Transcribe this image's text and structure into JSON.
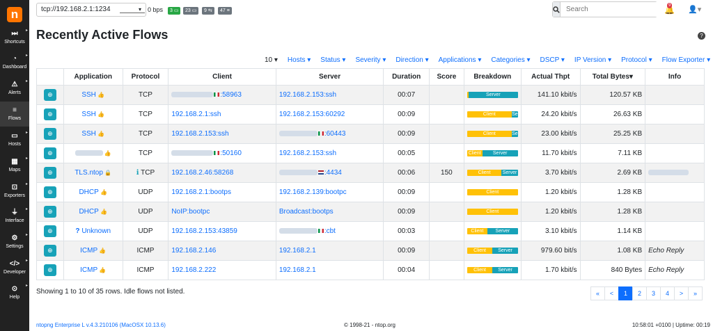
{
  "sidebar": {
    "logo": "n",
    "items": [
      {
        "icon": "⏭",
        "label": "Shortcuts",
        "icon_name": "forward-icon"
      },
      {
        "icon": "◔",
        "label": "Dashboard",
        "icon_name": "gauge-icon"
      },
      {
        "icon": "⚠",
        "label": "Alerts",
        "icon_name": "warning-icon"
      },
      {
        "icon": "≡",
        "label": "Flows",
        "icon_name": "stream-icon"
      },
      {
        "icon": "▭",
        "label": "Hosts",
        "icon_name": "laptop-icon"
      },
      {
        "icon": "▦",
        "label": "Maps",
        "icon_name": "map-icon"
      },
      {
        "icon": "⊡",
        "label": "Exporters",
        "icon_name": "exporter-icon"
      },
      {
        "icon": "⏚",
        "label": "Interface",
        "icon_name": "ethernet-icon"
      },
      {
        "icon": "⚙",
        "label": "Settings",
        "icon_name": "gear-icon"
      },
      {
        "icon": "</>",
        "label": "Developer",
        "icon_name": "code-icon"
      },
      {
        "icon": "⊙",
        "label": "Help",
        "icon_name": "lifebuoy-icon"
      }
    ]
  },
  "topbar": {
    "interface": "tcp://192.168.2.1:1234",
    "throughput": "0 bps",
    "badges": [
      {
        "text": "3 ▭",
        "color": "#28a745"
      },
      {
        "text": "23 ▭",
        "color": "#6c757d"
      },
      {
        "text": "9 ⇆",
        "color": "#6c757d"
      },
      {
        "text": "47 ≡",
        "color": "#6c757d"
      }
    ],
    "search_placeholder": "Search",
    "alert_count": "9"
  },
  "page": {
    "title": "Recently Active Flows"
  },
  "filters": [
    {
      "label": "10 ▾",
      "dark": true
    },
    {
      "label": "Hosts ▾"
    },
    {
      "label": "Status ▾"
    },
    {
      "label": "Severity ▾"
    },
    {
      "label": "Direction ▾"
    },
    {
      "label": "Applications ▾"
    },
    {
      "label": "Categories ▾"
    },
    {
      "label": "DSCP ▾"
    },
    {
      "label": "IP Version ▾"
    },
    {
      "label": "Protocol ▾"
    },
    {
      "label": "Flow Exporter ▾"
    }
  ],
  "table": {
    "columns": [
      "",
      "Application",
      "Protocol",
      "Client",
      "Server",
      "Duration",
      "Score",
      "Breakdown",
      "Actual Thpt",
      "Total Bytes▾",
      "Info"
    ],
    "rows": [
      {
        "app": "SSH",
        "app_icon": "thumb",
        "proto": "TCP",
        "proto_info": false,
        "client": ":58963",
        "client_blur": 60,
        "client_flag": "it",
        "server": "192.168.2.153:ssh",
        "server_blur": 0,
        "server_flag": "",
        "duration": "00:07",
        "score": "",
        "cl": 3,
        "sv": 97,
        "cl_label": "",
        "sv_label": "Server",
        "thpt": "141.10 kbit/s",
        "bytes": "120.57 KB",
        "info": "",
        "info_blur": false
      },
      {
        "app": "SSH",
        "app_icon": "thumb",
        "proto": "TCP",
        "proto_info": false,
        "client": "192.168.2.1:ssh",
        "client_blur": 0,
        "client_flag": "",
        "server": "192.168.2.153:60292",
        "server_blur": 0,
        "server_flag": "",
        "duration": "00:09",
        "score": "",
        "cl": 88,
        "sv": 12,
        "cl_label": "Client",
        "sv_label": "Se",
        "thpt": "24.20 kbit/s",
        "bytes": "26.63 KB",
        "info": "",
        "info_blur": false
      },
      {
        "app": "SSH",
        "app_icon": "thumb",
        "proto": "TCP",
        "proto_info": false,
        "client": "192.168.2.153:ssh",
        "client_blur": 0,
        "client_flag": "",
        "server": ":60443",
        "server_blur": 55,
        "server_flag": "it",
        "duration": "00:09",
        "score": "",
        "cl": 88,
        "sv": 12,
        "cl_label": "Client",
        "sv_label": "Se",
        "thpt": "23.00 kbit/s",
        "bytes": "25.25 KB",
        "info": "",
        "info_blur": false
      },
      {
        "app": "",
        "app_icon": "blur-thumb",
        "proto": "TCP",
        "proto_info": false,
        "client": ":50160",
        "client_blur": 60,
        "client_flag": "it",
        "server": "192.168.2.153:ssh",
        "server_blur": 0,
        "server_flag": "",
        "duration": "00:05",
        "score": "",
        "cl": 30,
        "sv": 70,
        "cl_label": "Client",
        "sv_label": "Server",
        "thpt": "11.70 kbit/s",
        "bytes": "7.11 KB",
        "info": "",
        "info_blur": false
      },
      {
        "app": "TLS.ntop",
        "app_icon": "lock",
        "proto": "TCP",
        "proto_info": true,
        "client": "192.168.2.46:58268",
        "client_blur": 0,
        "client_flag": "",
        "server": ":4434",
        "server_blur": 55,
        "server_flag": "nl",
        "duration": "00:06",
        "score": "150",
        "cl": 68,
        "sv": 32,
        "cl_label": "Client",
        "sv_label": "Server",
        "thpt": "3.70 kbit/s",
        "bytes": "2.69 KB",
        "info": "",
        "info_blur": true
      },
      {
        "app": "DHCP",
        "app_icon": "thumb",
        "proto": "UDP",
        "proto_info": false,
        "client": "192.168.2.1:bootps",
        "client_blur": 0,
        "client_flag": "",
        "server": "192.168.2.139:bootpc",
        "server_blur": 0,
        "server_flag": "",
        "duration": "00:09",
        "score": "",
        "cl": 100,
        "sv": 0,
        "cl_label": "Client",
        "sv_label": "",
        "thpt": "1.20 kbit/s",
        "bytes": "1.28 KB",
        "info": "",
        "info_blur": false
      },
      {
        "app": "DHCP",
        "app_icon": "thumb",
        "proto": "UDP",
        "proto_info": false,
        "client": "NoIP:bootpc",
        "client_blur": 0,
        "client_flag": "",
        "server": "Broadcast:bootps",
        "server_blur": 0,
        "server_flag": "",
        "duration": "00:09",
        "score": "",
        "cl": 100,
        "sv": 0,
        "cl_label": "Client",
        "sv_label": "",
        "thpt": "1.20 kbit/s",
        "bytes": "1.28 KB",
        "info": "",
        "info_blur": false
      },
      {
        "app": "Unknown",
        "app_icon": "question",
        "proto": "UDP",
        "proto_info": false,
        "client": "192.168.2.153:43859",
        "client_blur": 0,
        "client_flag": "",
        "server": ":cbt",
        "server_blur": 55,
        "server_flag": "it",
        "duration": "00:03",
        "score": "",
        "cl": 40,
        "sv": 60,
        "cl_label": "Client",
        "sv_label": "Server",
        "thpt": "3.10 kbit/s",
        "bytes": "1.14 KB",
        "info": "",
        "info_blur": false
      },
      {
        "app": "ICMP",
        "app_icon": "thumb",
        "proto": "ICMP",
        "proto_info": false,
        "client": "192.168.2.146",
        "client_blur": 0,
        "client_flag": "",
        "server": "192.168.2.1",
        "server_blur": 0,
        "server_flag": "",
        "duration": "00:09",
        "score": "",
        "cl": 50,
        "sv": 50,
        "cl_label": "Client",
        "sv_label": "Server",
        "thpt": "979.60 bit/s",
        "bytes": "1.08 KB",
        "info": "Echo Reply",
        "info_blur": false
      },
      {
        "app": "ICMP",
        "app_icon": "thumb",
        "proto": "ICMP",
        "proto_info": false,
        "client": "192.168.2.222",
        "client_blur": 0,
        "client_flag": "",
        "server": "192.168.2.1",
        "server_blur": 0,
        "server_flag": "",
        "duration": "00:04",
        "score": "",
        "cl": 50,
        "sv": 50,
        "cl_label": "Client",
        "sv_label": "Server",
        "thpt": "1.70 kbit/s",
        "bytes": "840 Bytes",
        "info": "Echo Reply",
        "info_blur": false
      }
    ]
  },
  "row_info": "Showing 1 to 10 of 35 rows. Idle flows not listed.",
  "pagination": [
    "«",
    "<",
    "1",
    "2",
    "3",
    "4",
    ">",
    "»"
  ],
  "pagination_active": "1",
  "footer": {
    "version": "ntopng Enterprise L v.4.3.210106 (MacOSX 10.13.6)",
    "copyright": "© 1998-21 - ntop.org",
    "status": "10:58:01 +0100 | Uptime: 00:19"
  },
  "colors": {
    "accent": "#0d6efd",
    "zoom": "#17a2b8",
    "client": "#ffc107",
    "server": "#17a2b8",
    "brand": "#ff7500"
  }
}
